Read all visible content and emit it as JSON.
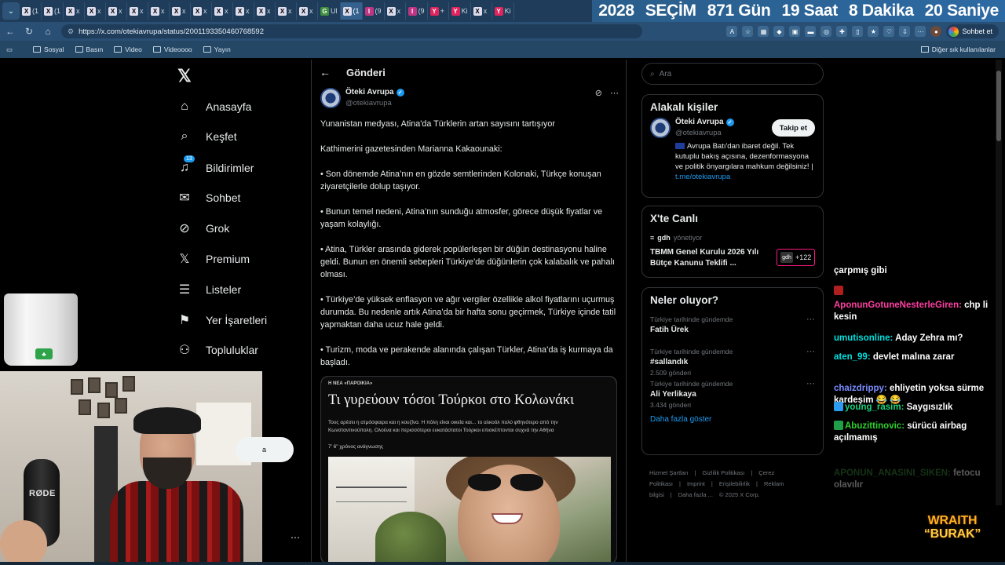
{
  "browser": {
    "tabs": [
      {
        "favicon": "X",
        "label": "(1"
      },
      {
        "favicon": "X",
        "label": "(1"
      },
      {
        "favicon": "X",
        "label": "x"
      },
      {
        "favicon": "X",
        "label": "x"
      },
      {
        "favicon": "X",
        "label": "x"
      },
      {
        "favicon": "X",
        "label": "x"
      },
      {
        "favicon": "X",
        "label": "x"
      },
      {
        "favicon": "X",
        "label": "x"
      },
      {
        "favicon": "X",
        "label": "x"
      },
      {
        "favicon": "X",
        "label": "x"
      },
      {
        "favicon": "X",
        "label": "x"
      },
      {
        "favicon": "X",
        "label": "x"
      },
      {
        "favicon": "X",
        "label": "x"
      },
      {
        "favicon": "X",
        "label": "x"
      },
      {
        "favicon": "G",
        "label": "Ul"
      },
      {
        "favicon": "X",
        "label": "(1"
      },
      {
        "favicon": "I",
        "label": "(9"
      },
      {
        "favicon": "X",
        "label": "x"
      },
      {
        "favicon": "I",
        "label": "(9"
      },
      {
        "favicon": "Y",
        "label": "+"
      },
      {
        "favicon": "Y",
        "label": "Ki"
      },
      {
        "favicon": "X",
        "label": "x"
      },
      {
        "favicon": "Y",
        "label": "Ki"
      }
    ],
    "countdown": {
      "year": "2028",
      "label": "SEÇİM",
      "days": "871 Gün",
      "hours": "19 Saat",
      "minutes": "8 Dakika",
      "seconds": "20 Saniye"
    },
    "url": "https://x.com/otekiavrupa/status/2001193350460768592",
    "chat_button": "Sohbet et",
    "bookmarks": [
      "Sosyal",
      "Basın",
      "Video",
      "Videoooo",
      "Yayın"
    ],
    "bookmarks_other": "Diğer sık kullanılanlar"
  },
  "nav": {
    "items": [
      {
        "label": "Anasayfa",
        "icon": "home-icon"
      },
      {
        "label": "Keşfet",
        "icon": "search-icon"
      },
      {
        "label": "Bildirimler",
        "icon": "bell-icon",
        "badge": "13"
      },
      {
        "label": "Sohbet",
        "icon": "mail-icon"
      },
      {
        "label": "Grok",
        "icon": "grok-icon"
      },
      {
        "label": "Premium",
        "icon": "x-premium-icon"
      },
      {
        "label": "Listeler",
        "icon": "list-icon"
      },
      {
        "label": "Yer İşaretleri",
        "icon": "bookmark-icon"
      },
      {
        "label": "Topluluklar",
        "icon": "communities-icon"
      }
    ],
    "post_button_fragment": "a"
  },
  "post": {
    "header": "Gönderi",
    "author_name": "Öteki Avrupa",
    "author_handle": "@otekiavrupa",
    "paragraphs": [
      "Yunanistan medyası, Atina'da Türklerin artan sayısını tartışıyor",
      "Kathimerini gazetesinden Marianna Kakaounaki:",
      "• Son dönemde Atina’nın en gözde semtlerinden Kolonaki, Türkçe konuşan ziyaretçilerle dolup taşıyor.",
      "• Bunun temel nedeni, Atina’nın sunduğu atmosfer, görece düşük fiyatlar ve yaşam kolaylığı.",
      "• Atina, Türkler arasında giderek popülerleşen bir düğün destinasyonu haline geldi. Bunun en önemli sebepleri Türkiye’de düğünlerin çok kalabalık ve pahalı olması.",
      "• Türkiye’de yüksek enflasyon ve ağır vergiler özellikle alkol fiyatlarını uçurmuş durumda. Bu nedenle artık Atina’da bir hafta sonu geçirmek, Türkiye içinde tatil yapmaktan daha ucuz hale geldi.",
      "• Turizm, moda ve perakende alanında çalışan Türkler, Atina’da iş kurmaya da başladı."
    ],
    "media": {
      "tag": "Η ΝΕΑ «ΠΑΡΟΙΚΙΑ»",
      "title": "Τι γυρεύουν τόσοι Τούρκοι στο Κολωνάκι",
      "subtitle": "Τους αρέσει η ατμόσφαιρα και η κουζίνα. Η πόλη είναι οικεία και... το αλκοόλ πολύ φθηνότερο από την Κωνσταντινούπολη. Ολοένα και περισσότεροι ευκατάστατοι Τούρκοι επισκέπτονται συχνά την Αθήνα",
      "read_time": "7' 6\" χρόνος ανάγνωσης"
    }
  },
  "sidebar": {
    "search_placeholder": "Ara",
    "related_title": "Alakalı kişiler",
    "related": {
      "name": "Öteki Avrupa",
      "handle": "@otekiavrupa",
      "follow_label": "Takip et",
      "bio": "Avrupa Batı'dan ibaret değil. Tek kutuplu bakış açısına, dezenformasyona ve politik önyargılara mahkum değilsiniz! |",
      "bio_link": "t.me/otekiavrupa"
    },
    "live_title": "X'te Canlı",
    "live": {
      "host": "gdh",
      "host_role": "yönetiyor",
      "title": "TBMM Genel Kurulu 2026 Yılı Bütçe Kanunu Teklifi ...",
      "avatar_label": "gdh",
      "count": "+122"
    },
    "trends_title": "Neler oluyor?",
    "trends": [
      {
        "context": "Türkiye tarihinde gündemde",
        "name": "Fatih Ürek",
        "count": ""
      },
      {
        "context": "Türkiye tarihinde gündemde",
        "name": "#sallandık",
        "count": "2.509 gönderi"
      },
      {
        "context": "Türkiye tarihinde gündemde",
        "name": "Ali Yerlikaya",
        "count": "3.434 gönderi"
      }
    ],
    "show_more": "Daha fazla göster",
    "footer": [
      "Hizmet Şartları",
      "|",
      "Gizlilik Politikası",
      "|",
      "Çerez Politikası",
      "|",
      "Imprint",
      "|",
      "Erişilebilirlik",
      "|",
      "Reklam bilgisi",
      "|",
      "Daha fazla ...",
      "© 2025 X Corp."
    ]
  },
  "stream": {
    "cup_logo": "♣",
    "mic_label": "RØDE",
    "chat": [
      {
        "user": "",
        "user_color": "#ffffff",
        "text": "çarpmış gibi",
        "emote": ""
      },
      {
        "user": "",
        "user_color": "#ffffff",
        "text": "",
        "emote": "#b01e1e"
      },
      {
        "user": "AponunGotuneNesterleGiren:",
        "user_color": "#ff3fa2",
        "text": "chp li kesin",
        "emote": ""
      },
      {
        "user": "umutisonline:",
        "user_color": "#00e0e0",
        "text": "Aday Zehra mı?",
        "emote": ""
      },
      {
        "user": "aten_99:",
        "user_color": "#00e0e0",
        "text": "devlet malına zarar",
        "emote": ""
      },
      {
        "user": "chaizdrippy:",
        "user_color": "#7b8cff",
        "text": "ehliyetin yoksa sürme kardeşim 😂 😂",
        "emote": ""
      },
      {
        "user": "young_rasim:",
        "user_color": "#19d37c",
        "text": "Saygısızlık",
        "emote": "#2d9bf0"
      },
      {
        "user": "Abuzittinovic:",
        "user_color": "#2ed12e",
        "text": "sürücü airbag açılmamış",
        "emote": "#1f9f4a"
      },
      {
        "user": "APONUN_ANASINI_SIKEN:",
        "user_color": "#3f8f3f",
        "text": "fetocu olavılır",
        "emote": ""
      }
    ],
    "overlay_line1": "WRAITH",
    "overlay_line2": "“BURAK”"
  }
}
